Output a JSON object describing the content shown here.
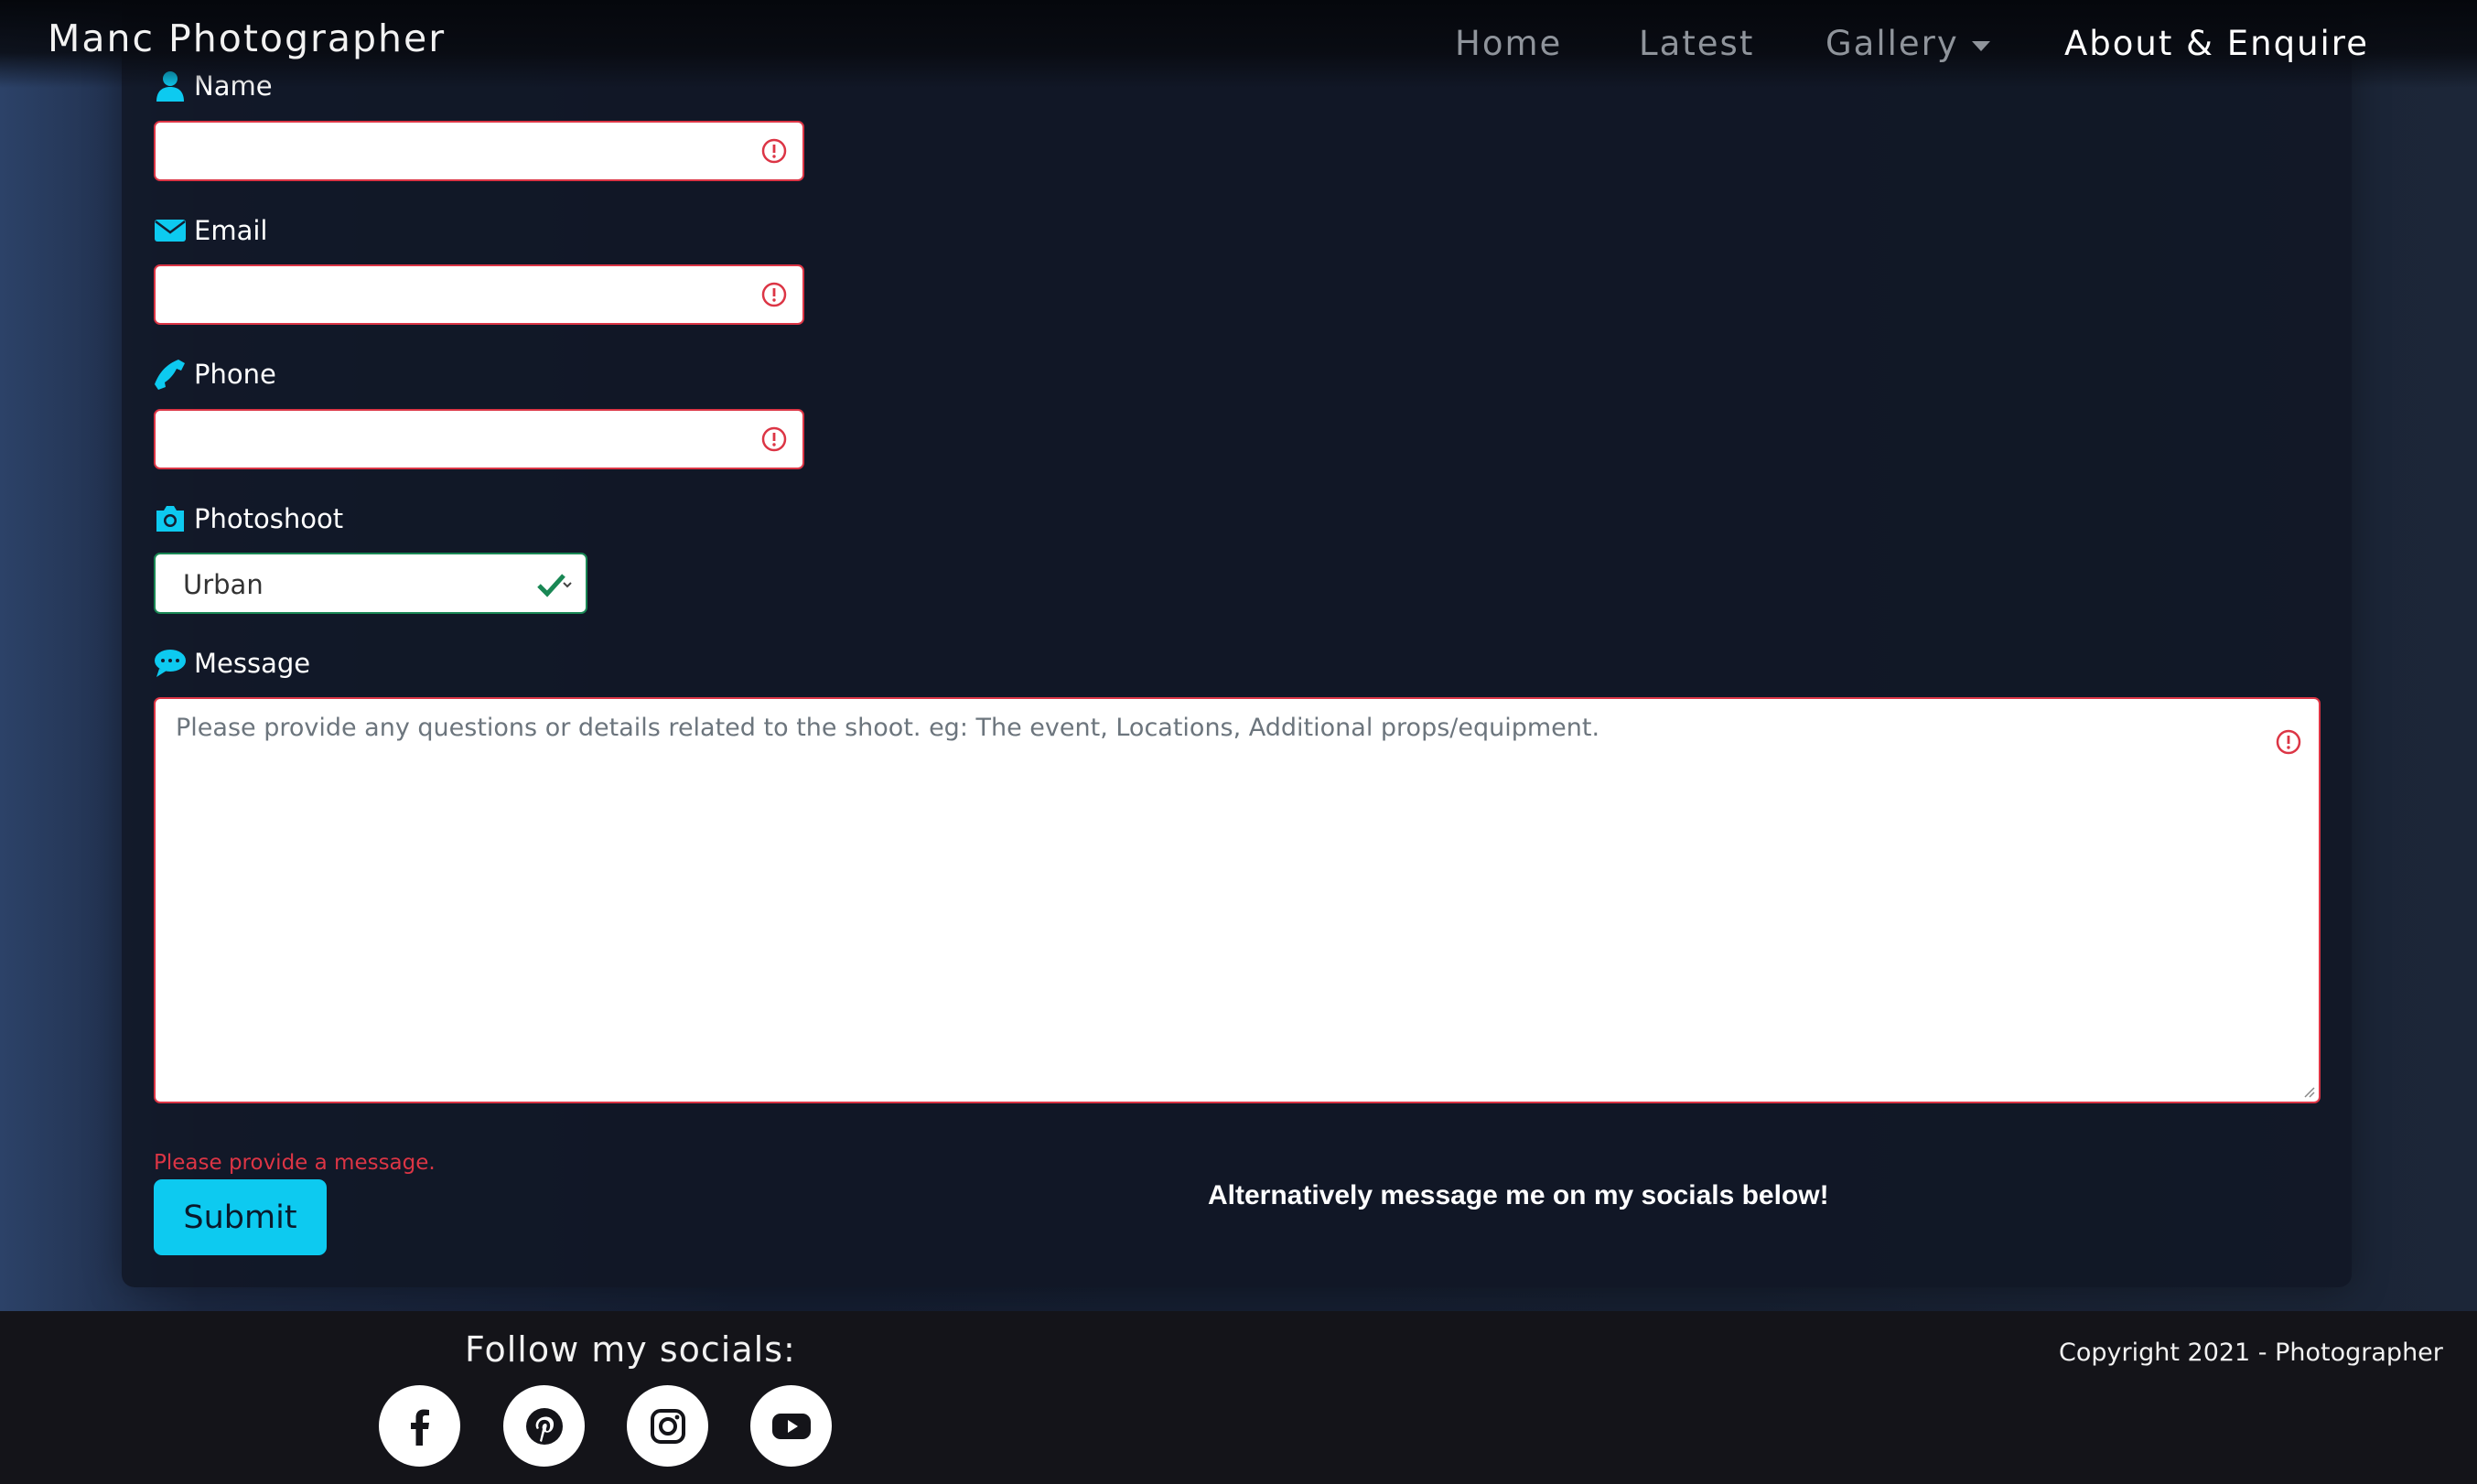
{
  "navbar": {
    "brand": "Manc Photographer",
    "links": {
      "home": "Home",
      "latest": "Latest",
      "gallery": "Gallery",
      "about": "About & Enquire"
    }
  },
  "form": {
    "name_label": "Name",
    "name_value": "",
    "email_label": "Email",
    "email_value": "",
    "phone_label": "Phone",
    "phone_value": "",
    "photoshoot_label": "Photoshoot",
    "photoshoot_selected": "Urban",
    "message_label": "Message",
    "message_placeholder": "Please provide any questions or details related to the shoot. eg: The event, Locations, Additional props/equipment.",
    "message_error": "Please provide a message.",
    "submit_label": "Submit",
    "alternative_text": "Alternatively message me on my socials below!"
  },
  "footer": {
    "follow_heading": "Follow my socials:",
    "socials": [
      "facebook-icon",
      "pinterest-icon",
      "instagram-icon",
      "youtube-icon"
    ],
    "copyright": "Copyright 2021 - Photographer"
  },
  "colors": {
    "accent": "#0dcaf0",
    "error": "#dc3545",
    "valid": "#198754"
  }
}
